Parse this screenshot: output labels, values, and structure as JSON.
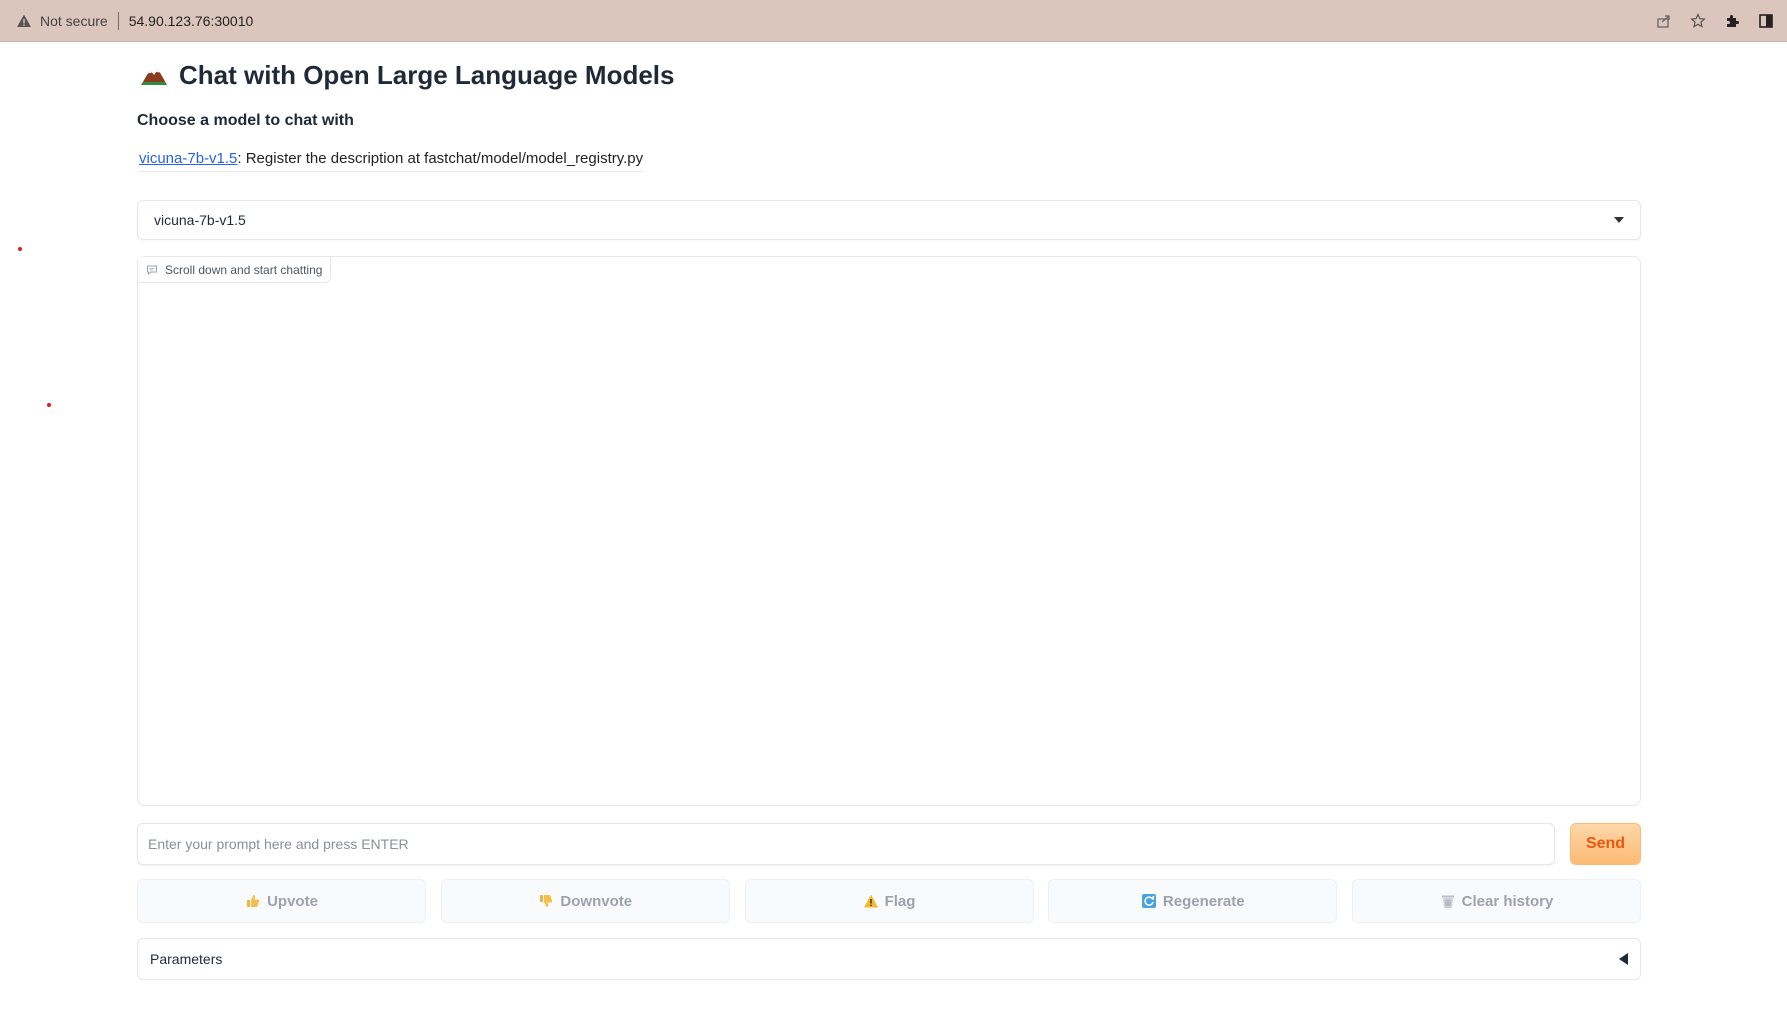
{
  "browser": {
    "security_label": "Not secure",
    "url": "54.90.123.76:30010",
    "icons": [
      "warning-icon",
      "share-icon",
      "star-icon",
      "extensions-icon",
      "sidepanel-icon"
    ]
  },
  "page": {
    "title": "Chat with Open Large Language Models",
    "title_icon": "mountain-icon",
    "subtitle": "Choose a model to chat with",
    "model_link": "vicuna-7b-v1.5",
    "model_description": ": Register the description at fastchat/model/model_registry.py"
  },
  "model_select": {
    "selected": "vicuna-7b-v1.5"
  },
  "chatbot": {
    "label": "Scroll down and start chatting",
    "label_icon": "chat-bubble-icon"
  },
  "input": {
    "placeholder": "Enter your prompt here and press ENTER",
    "value": ""
  },
  "send_label": "Send",
  "actions": [
    {
      "label": "Upvote",
      "icon": "thumbs-up-icon"
    },
    {
      "label": "Downvote",
      "icon": "thumbs-down-icon"
    },
    {
      "label": "Flag",
      "icon": "warning-icon"
    },
    {
      "label": "Regenerate",
      "icon": "refresh-icon"
    },
    {
      "label": "Clear history",
      "icon": "trash-icon"
    }
  ],
  "parameters_label": "Parameters",
  "colors": {
    "address_bar": "#dcc5bd",
    "link": "#2563eb",
    "send_text": "#ea580c",
    "send_bg": "#fdba74",
    "disabled_text": "#9ca3af"
  }
}
